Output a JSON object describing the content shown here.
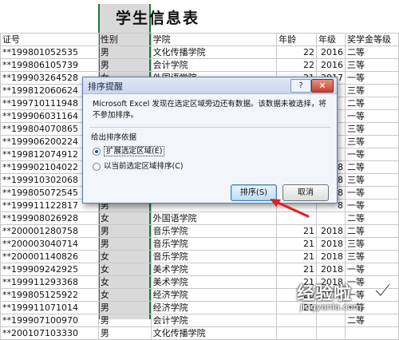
{
  "sheet": {
    "title": "学生信息表",
    "headers": [
      "证号",
      "性别",
      "学院",
      "年龄",
      "年级",
      "奖学金等级"
    ],
    "rows": [
      [
        "**199801052535",
        "男",
        "文化传播学院",
        "22",
        "2016",
        "二等"
      ],
      [
        "**199806105739",
        "男",
        "会计学院",
        "22",
        "2016",
        "三等"
      ],
      [
        "**199903264528",
        "女",
        "外国语学院",
        "21",
        "2017",
        "一等"
      ],
      [
        "**199812060624",
        "女",
        "",
        "",
        "",
        "三等"
      ],
      [
        "**199710111948",
        "女",
        "",
        "",
        "",
        "二等"
      ],
      [
        "**199906031164",
        "女",
        "",
        "",
        "",
        "一等"
      ],
      [
        "**199804070865",
        "女",
        "",
        "",
        "",
        "三等"
      ],
      [
        "**199906200224",
        "女",
        "",
        "",
        "",
        "三等"
      ],
      [
        "**199812074912",
        "男",
        "",
        "",
        "",
        "一等"
      ],
      [
        "**199902104022",
        "女",
        "",
        "",
        "8",
        "二等"
      ],
      [
        "**199910302068",
        "女",
        "",
        "",
        "8",
        "三等"
      ],
      [
        "**199805072545",
        "女",
        "",
        "",
        "8",
        "一等"
      ],
      [
        "**199911122817",
        "男",
        "",
        "",
        "8",
        "一等"
      ],
      [
        "**199908026928",
        "女",
        "外国语学院",
        "",
        "",
        "二等"
      ],
      [
        "**200001280758",
        "男",
        "音乐学院",
        "21",
        "2018",
        "二等"
      ],
      [
        "**200003040714",
        "男",
        "音乐学院",
        "21",
        "2018",
        "三等"
      ],
      [
        "**200001140826",
        "女",
        "音乐学院",
        "21",
        "2018",
        "三等"
      ],
      [
        "**199909242925",
        "女",
        "美术学院",
        "21",
        "2018",
        "一等"
      ],
      [
        "**199911293368",
        "女",
        "美术学院",
        "21",
        "2018",
        "一等"
      ],
      [
        "**199805125922",
        "女",
        "经济学院",
        "20",
        "2018",
        "一等"
      ],
      [
        "**199911071014",
        "男",
        "经济学院",
        "21",
        "",
        "一等"
      ],
      [
        "**199907100970",
        "男",
        "会计学院",
        "",
        "",
        "二等"
      ],
      [
        "**200107103330",
        "男",
        "文化传播学院",
        "",
        "",
        ""
      ]
    ]
  },
  "dialog": {
    "title": "排序提醒",
    "help": "?",
    "close": "✕",
    "message": "Microsoft Excel 发现在选定区域旁边还有数据。该数据未被选择，将不参加排序。",
    "group_label": "给出排序依据",
    "option_expand": "扩展选定区域(E)",
    "option_current": "以当前选定区域排序(C)",
    "sort_button": "排序(S)",
    "cancel_button": "取消"
  },
  "watermark": {
    "brand": "经验啦",
    "url": "jingyanla.com"
  },
  "colors": {
    "selection_border": "#217346",
    "selection_fill": "#d9d9d9",
    "arrow": "#e02020"
  }
}
